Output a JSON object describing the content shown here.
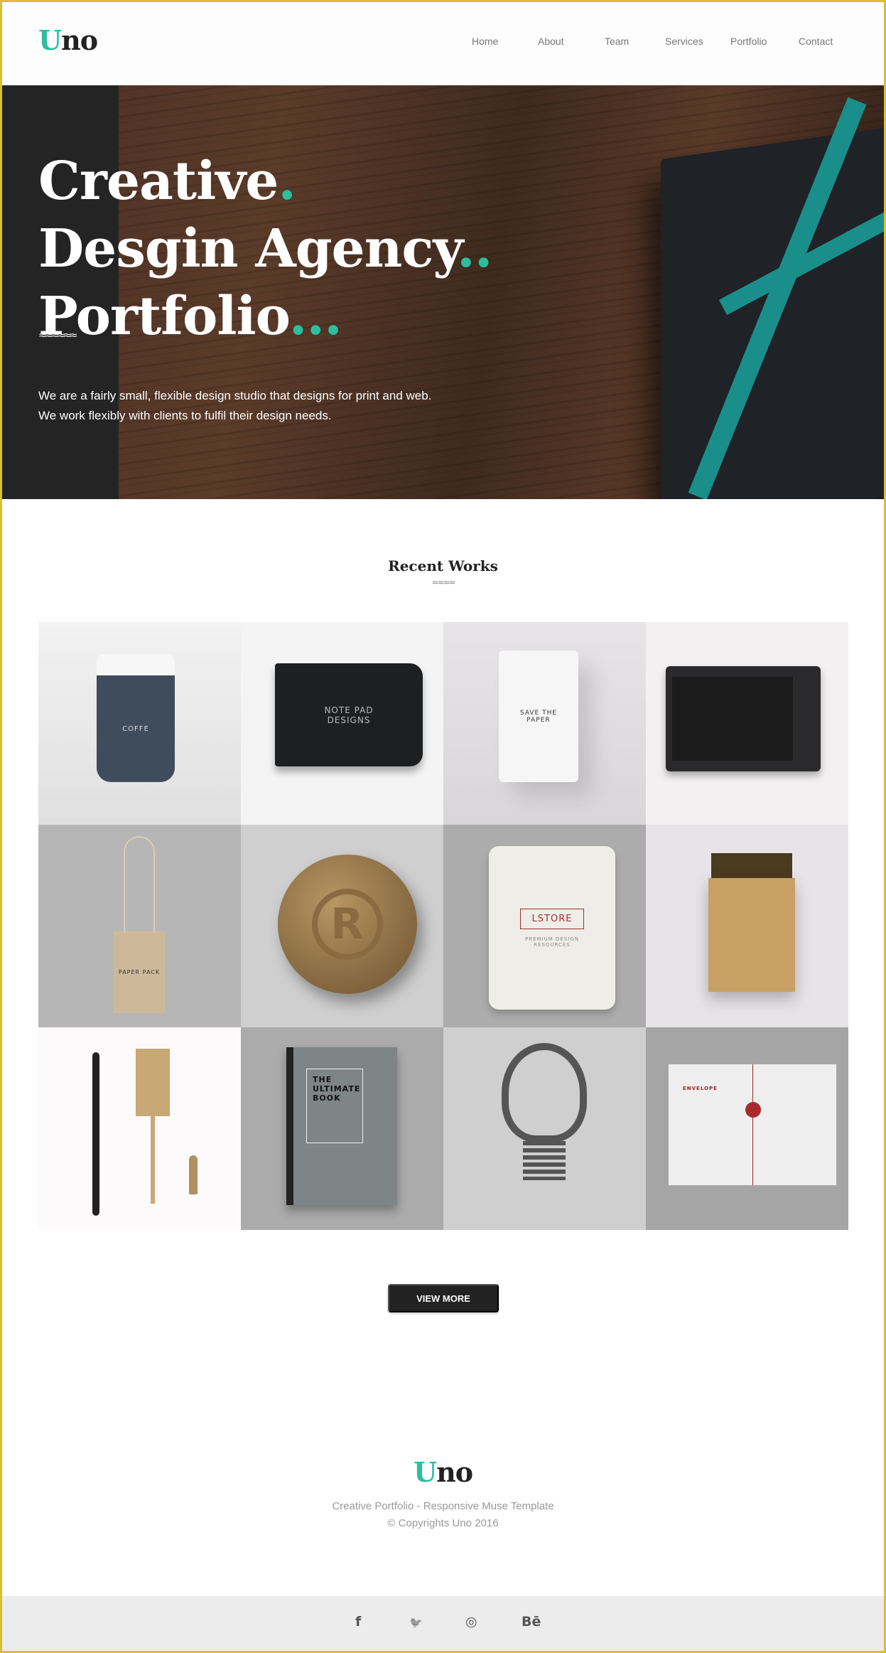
{
  "brand": {
    "logo_first": "U",
    "logo_rest": "no",
    "accent": "#2bbf9e"
  },
  "nav": [
    {
      "label": "Home"
    },
    {
      "label": "About"
    },
    {
      "label": "Team"
    },
    {
      "label": "Services"
    },
    {
      "label": "Portfolio"
    },
    {
      "label": "Contact"
    }
  ],
  "hero": {
    "line1": "Creative",
    "dots1": ".",
    "line2": "Desgin Agency",
    "dots2": "..",
    "line3": "Portfolio",
    "dots3": "...",
    "wave": "≈≈≈≈≈≈",
    "para1": "We are a fairly small, flexible design studio that designs for print and web.",
    "para2": "We work flexibly with clients to fulfil their design needs."
  },
  "recent": {
    "title": "Recent Works",
    "wave": "≈≈≈≈",
    "items": [
      {
        "name": "coffee-cup",
        "label": "COFFE"
      },
      {
        "name": "notepad",
        "label": "NOTE PAD DESIGNS"
      },
      {
        "name": "paper-bag",
        "label": "SAVE THE PAPER"
      },
      {
        "name": "tablet",
        "label": ""
      },
      {
        "name": "paper-pack",
        "label": "PAPER PACK"
      },
      {
        "name": "bronze-seal",
        "label": "R"
      },
      {
        "name": "cloth-bag",
        "label": "LSTORE",
        "sublabel": "PREMIUM DESIGN RESOURCES"
      },
      {
        "name": "kraft-box",
        "label": ""
      },
      {
        "name": "pen-tools",
        "label": ""
      },
      {
        "name": "book",
        "label": "THE ULTIMATE BOOK"
      },
      {
        "name": "lightbulb",
        "label": ""
      },
      {
        "name": "envelope",
        "label": "ENVELOPE"
      }
    ],
    "view_more": "VIEW MORE"
  },
  "footer": {
    "tagline": "Creative Portfolio - Responsive Muse Template",
    "copyright": "© Copyrights Uno 2016"
  },
  "social": [
    {
      "icon": "facebook-icon",
      "glyph": "f"
    },
    {
      "icon": "twitter-icon",
      "glyph": "🐦"
    },
    {
      "icon": "dribbble-icon",
      "glyph": "◎"
    },
    {
      "icon": "behance-icon",
      "glyph": "Bē"
    }
  ]
}
